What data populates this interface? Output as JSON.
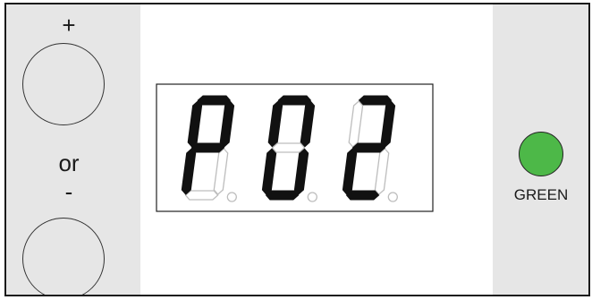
{
  "controls": {
    "plus_label": "+",
    "or_label": "or",
    "minus_label": "-"
  },
  "display": {
    "digits": [
      {
        "char": "P",
        "segments": [
          "a",
          "b",
          "e",
          "f",
          "g"
        ]
      },
      {
        "char": "0",
        "segments": [
          "a",
          "b",
          "c",
          "d",
          "e",
          "f"
        ]
      },
      {
        "char": "2",
        "segments": [
          "a",
          "b",
          "d",
          "e",
          "g"
        ]
      }
    ],
    "on_color": "#111111",
    "off_color": "#bdbdbd"
  },
  "indicator": {
    "label": "GREEN",
    "color": "#4db848"
  }
}
